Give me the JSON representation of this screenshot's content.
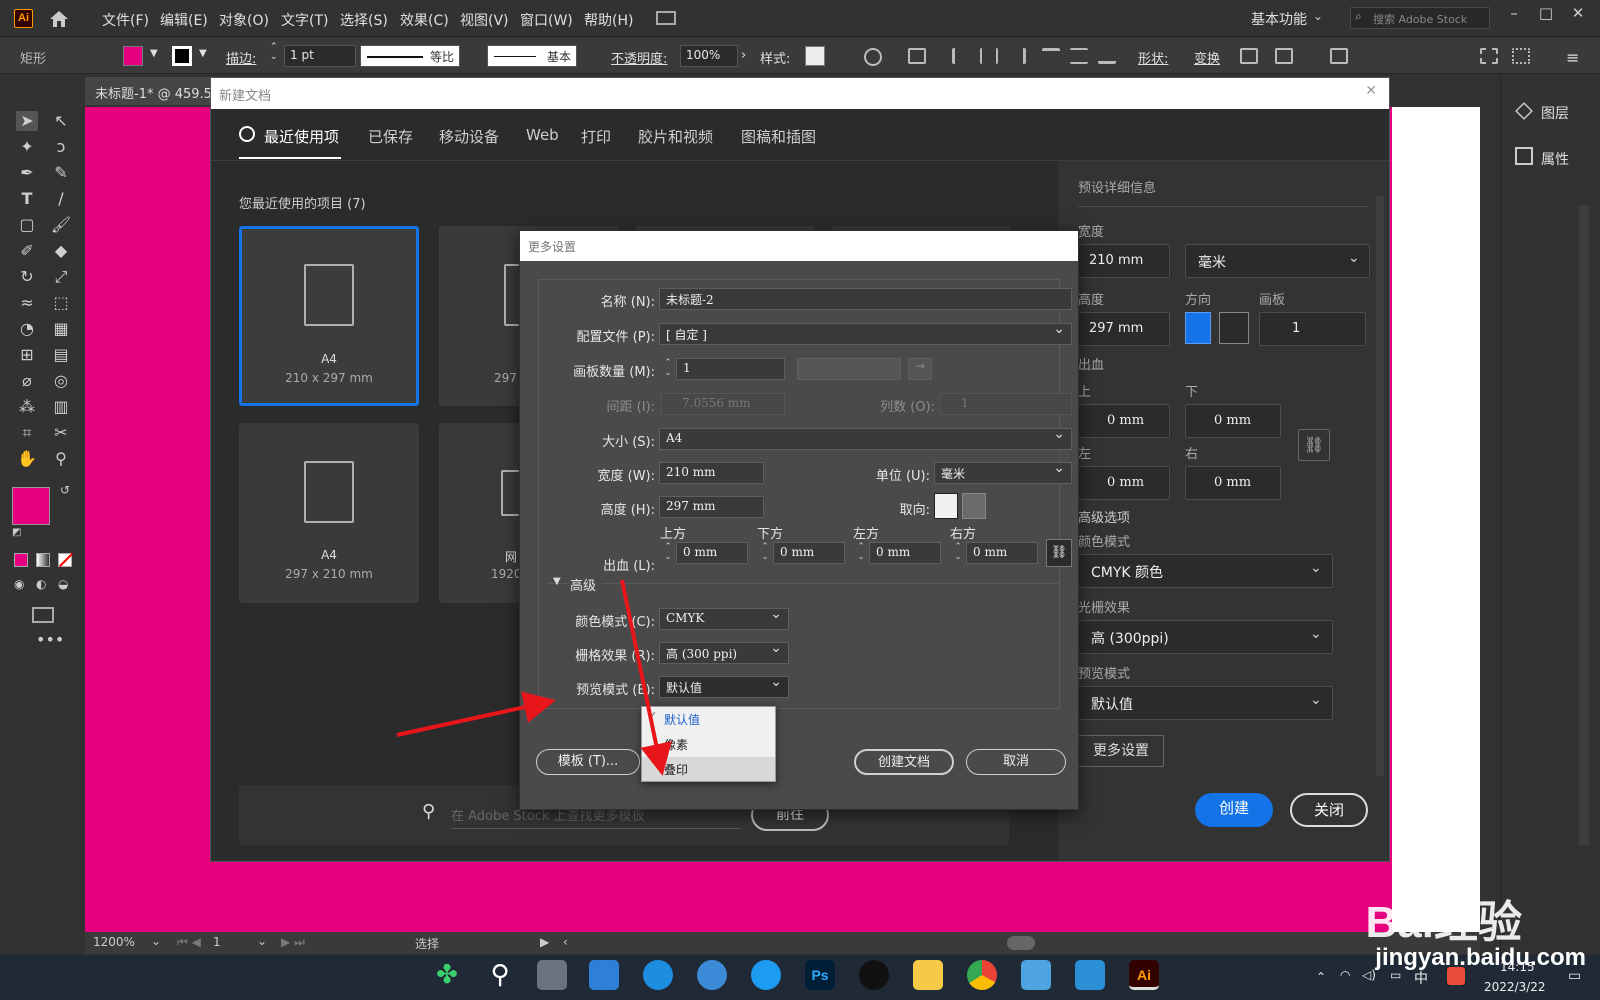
{
  "app": {
    "logo": "Ai"
  },
  "menu": [
    "文件(F)",
    "编辑(E)",
    "对象(O)",
    "文字(T)",
    "选择(S)",
    "效果(C)",
    "视图(V)",
    "窗口(W)",
    "帮助(H)"
  ],
  "workspace": "基本功能",
  "stock_search_placeholder": "搜索 Adobe Stock",
  "control_bar": {
    "object_label": "矩形",
    "stroke_label": "描边:",
    "stroke_value": "1 pt",
    "stroke_profile": "等比",
    "brush": "基本",
    "opacity_label": "不透明度:",
    "opacity_value": "100%",
    "style_label": "样式:",
    "shape_label": "形状:",
    "transform_label": "变换",
    "fill_color": "#e5007f"
  },
  "document_tab": "未标题-1* @ 459.5",
  "right_panel": {
    "layers": "图层",
    "properties": "属性"
  },
  "status_bar": {
    "zoom": "1200%",
    "page": "1",
    "tool": "选择"
  },
  "taskbar": {
    "time": "14:15",
    "date": "2022/3/22",
    "ime": "中"
  },
  "new_document": {
    "title": "新建文档",
    "tabs": [
      "最近使用项",
      "已保存",
      "移动设备",
      "Web",
      "打印",
      "胶片和视频",
      "图稿和插图"
    ],
    "recent_title": "您最近使用的项目 (7)",
    "cards": [
      {
        "name": "A4",
        "size": "210 x 297 mm"
      },
      {
        "name": "A4",
        "size": "297 x 210 mm"
      },
      {
        "name": "",
        "size": "297 x"
      },
      {
        "name": "网",
        "size": "1920 x"
      }
    ],
    "stock_placeholder": "在 Adobe Stock 上查找更多模板",
    "go_button": "前往",
    "preset_title": "预设详细信息",
    "width_label": "宽度",
    "width_value": "210 mm",
    "unit": "毫米",
    "height_label": "高度",
    "height_value": "297 mm",
    "orientation_label": "方向",
    "artboards_label": "画板",
    "artboards_value": "1",
    "bleed_label": "出血",
    "bleed_top_label": "上",
    "bleed_bottom_label": "下",
    "bleed_left_label": "左",
    "bleed_right_label": "右",
    "bleed_top": "0 mm",
    "bleed_bottom": "0 mm",
    "bleed_left": "0 mm",
    "bleed_right": "0 mm",
    "advanced_label": "高级选项",
    "color_mode_label": "颜色模式",
    "color_mode": "CMYK 颜色",
    "raster_label": "光栅效果",
    "raster": "高 (300ppi)",
    "preview_label": "预览模式",
    "preview": "默认值",
    "more_settings": "更多设置",
    "create": "创建",
    "close": "关闭"
  },
  "more_settings": {
    "title": "更多设置",
    "name_label": "名称 (N):",
    "name_value": "未标题-2",
    "profile_label": "配置文件 (P):",
    "profile_value": "[ 自定 ]",
    "artboards_label": "画板数量 (M):",
    "artboards_value": "1",
    "spacing_label": "间距 (I):",
    "spacing_value": "7.0556 mm",
    "columns_label": "列数 (O):",
    "columns_value": "1",
    "size_label": "大小 (S):",
    "size_value": "A4",
    "width_label": "宽度 (W):",
    "width_value": "210 mm",
    "unit_label": "单位 (U):",
    "unit_value": "毫米",
    "height_label": "高度 (H):",
    "height_value": "297 mm",
    "orientation_label": "取向:",
    "bleed_label": "出血 (L):",
    "bleed_top_label": "上方",
    "bleed_bottom_label": "下方",
    "bleed_left_label": "左方",
    "bleed_right_label": "右方",
    "bleed_top": "0 mm",
    "bleed_bottom": "0 mm",
    "bleed_left": "0 mm",
    "bleed_right": "0 mm",
    "advanced_label": "高级",
    "color_mode_label": "颜色模式 (C):",
    "color_mode": "CMYK",
    "raster_label": "栅格效果 (R):",
    "raster": "高 (300 ppi)",
    "preview_label": "预览模式 (E):",
    "preview": "默认值",
    "preview_options": [
      "默认值",
      "像素",
      "叠印"
    ],
    "template_button": "模板 (T)...",
    "create_button": "创建文档",
    "cancel_button": "取消"
  },
  "watermark": {
    "main": "Bai经验",
    "url": "jingyan.baidu.com"
  }
}
